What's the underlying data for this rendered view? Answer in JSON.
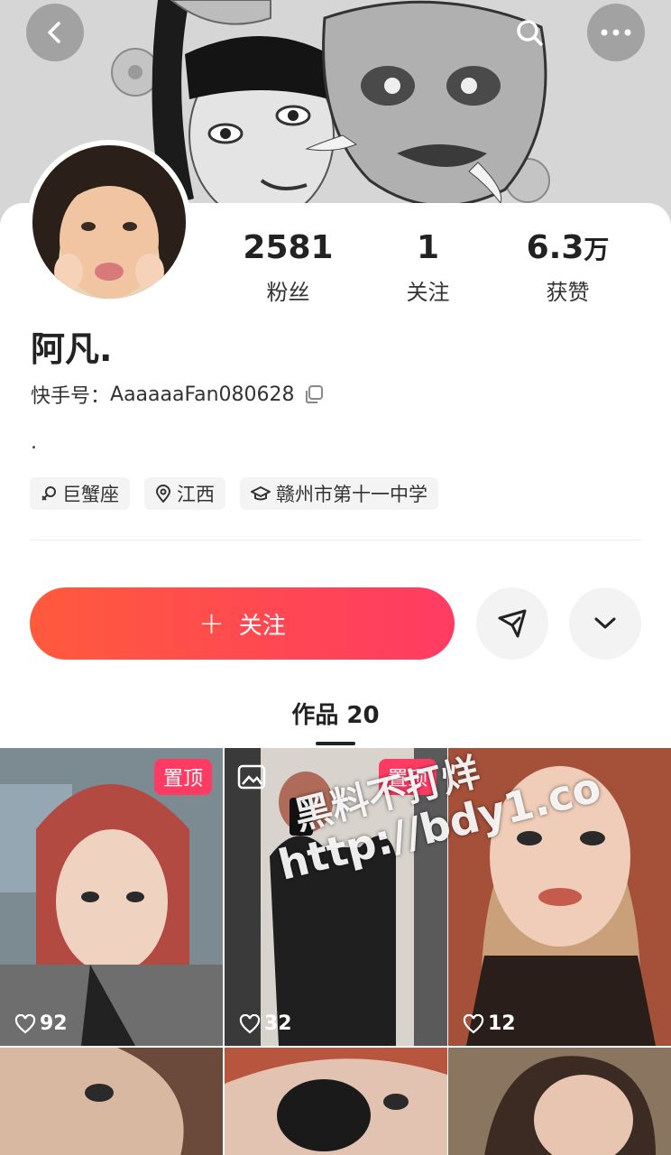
{
  "header": {
    "back_icon": "chevron-left-icon",
    "search_icon": "search-icon",
    "more_icon": "more-dots-icon"
  },
  "profile": {
    "name": "阿凡.",
    "kuaishou_id_label": "快手号：",
    "kuaishou_id": "AaaaaaFan080628",
    "bio": ".",
    "stats": [
      {
        "value": "2581",
        "unit": "",
        "label": "粉丝"
      },
      {
        "value": "1",
        "unit": "",
        "label": "关注"
      },
      {
        "value": "6.3",
        "unit": "万",
        "label": "获赞"
      }
    ],
    "tags": [
      {
        "icon": "zodiac-icon",
        "label": "巨蟹座"
      },
      {
        "icon": "location-pin-icon",
        "label": "江西"
      },
      {
        "icon": "graduation-cap-icon",
        "label": "赣州市第十一中学"
      }
    ]
  },
  "actions": {
    "follow_label": "关注",
    "follow_plus": "+"
  },
  "works_tab": {
    "label": "作品 20"
  },
  "videos": [
    {
      "pinned": true,
      "pin_label": "置顶",
      "likes": "92",
      "gallery": false
    },
    {
      "pinned": true,
      "pin_label": "置顶",
      "likes": "32",
      "gallery": true
    },
    {
      "pinned": false,
      "pin_label": "",
      "likes": "12",
      "gallery": false
    },
    {
      "pinned": false,
      "pin_label": "",
      "likes": "",
      "gallery": false
    },
    {
      "pinned": false,
      "pin_label": "",
      "likes": "",
      "gallery": false
    },
    {
      "pinned": false,
      "pin_label": "",
      "likes": "",
      "gallery": false
    }
  ],
  "watermark": {
    "line1": "黑料不打烊",
    "line2": "http://bdy1.co"
  },
  "colors": {
    "accent_gradient_start": "#ff5a3c",
    "accent_gradient_end": "#ff3b63",
    "pin_badge": "#ff3b63"
  }
}
